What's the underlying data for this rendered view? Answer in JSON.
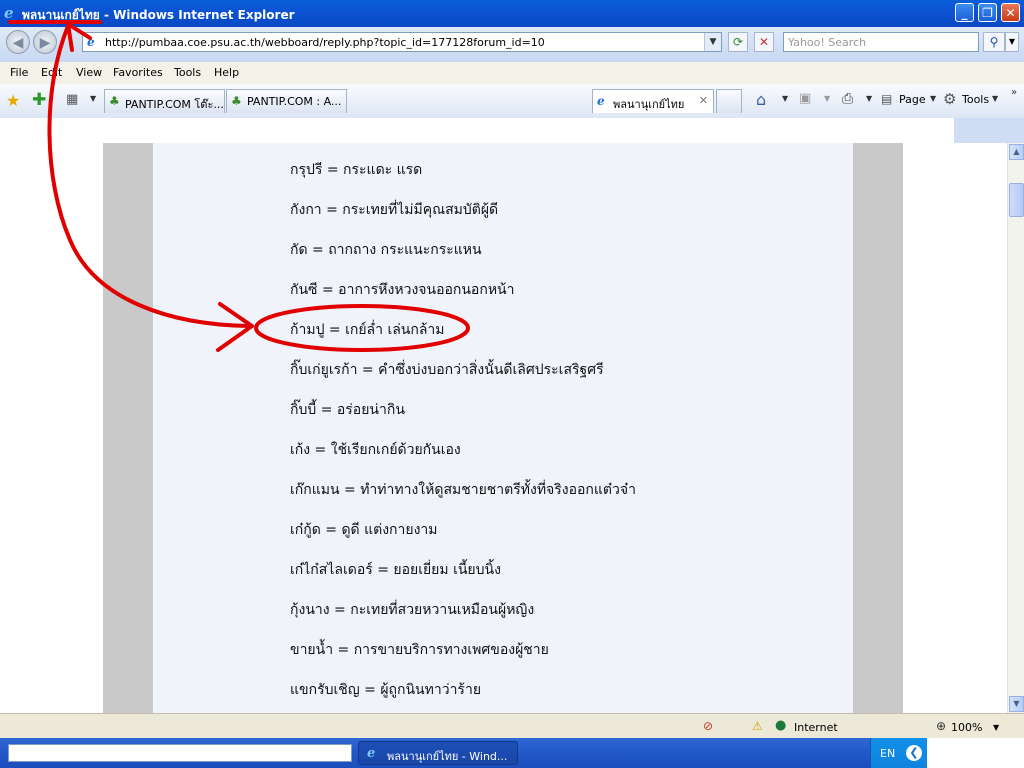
{
  "window": {
    "title": "พลนานุเกย์ไทย - Windows Internet Explorer",
    "minimize_icon": "minimize-icon",
    "maximize_icon": "restore-icon",
    "close_icon": "close-icon"
  },
  "address_bar": {
    "url": "http://pumbaa.coe.psu.ac.th/webboard/reply.php?topic_id=177128forum_id=10",
    "search_placeholder": "Yahoo! Search"
  },
  "menu": [
    "File",
    "Edit",
    "View",
    "Favorites",
    "Tools",
    "Help"
  ],
  "tabs": [
    {
      "label": "PANTIP.COM โต๊ะ...",
      "icon": "cactus-icon"
    },
    {
      "label": "PANTIP.COM : A...",
      "icon": "cactus-icon"
    },
    {
      "label": "พลนานุเกย์ไทย",
      "icon": "ie-icon",
      "active": true
    }
  ],
  "toolbar": {
    "page_label": "Page",
    "tools_label": "Tools"
  },
  "entries": [
    "กรุปรี = กระแดะ แรด",
    "กังกา = กระเทยที่ไม่มีคุณสมบัติผู้ดี",
    "กัด = ถากถาง กระแนะกระแหน",
    "กันซี = อาการหึงหวงจนออกนอกหน้า",
    "ก้ามปู = เกย์ล่ำ เล่นกล้าม",
    "กิ๊บเก่ยูเรก้า = คำซึ่งบ่งบอกว่าสิ่งนั้นดีเลิศประเสริฐศรี",
    "กิ๊บบี้ = อร่อยน่ากิน",
    "เก้ง = ใช้เรียกเกย์ด้วยกันเอง",
    "เก๊กแมน = ทำท่าทางให้ดูสมชายชาตรีทั้งที่จริงออกแต๋วจ๋า",
    "เก๋กู้ด = ดูดี แต่งกายงาม",
    "เก๋ไก๋สไลเดอร์ = ยอยเยี่ยม เนี้ยบนิ้ง",
    "กุ้งนาง = กะเทยที่สวยหวานเหมือนผู้หญิง",
    "ขายน้ำ = การขายบริการทางเพศของผู้ชาย",
    "แขกรับเชิญ = ผู้ถูกนินทาว่าร้าย"
  ],
  "status": {
    "zone": "Internet",
    "zoom": "100%"
  },
  "taskbar": {
    "window_label": "พลนานุเกย์ไทย - Wind...",
    "language": "EN"
  },
  "colors": {
    "annotation": "#e00000",
    "title_bar": "#0a54d4",
    "taskbar": "#2157c8"
  }
}
